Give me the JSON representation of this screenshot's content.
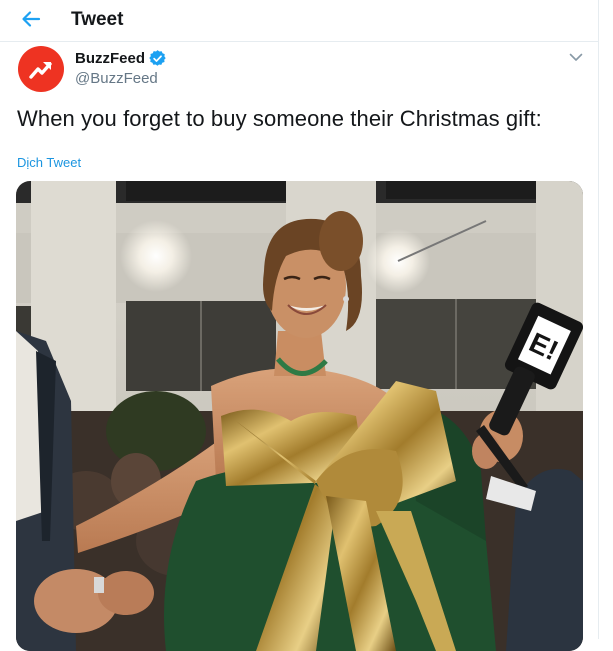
{
  "header": {
    "title": "Tweet"
  },
  "tweet": {
    "author_name": "BuzzFeed",
    "author_handle": "@BuzzFeed",
    "text": "When you forget to buy someone their Christmas gift:",
    "translate_label": "Dịch Tweet",
    "media_mic_label": "E!"
  },
  "colors": {
    "accent": "#1da1f2",
    "brand": "#ee3322",
    "verified": "#1da1f2"
  },
  "icons": {
    "back": "back-arrow-icon",
    "verified": "verified-badge-icon",
    "menu": "chevron-down-icon",
    "avatar": "trending-arrow-icon"
  }
}
